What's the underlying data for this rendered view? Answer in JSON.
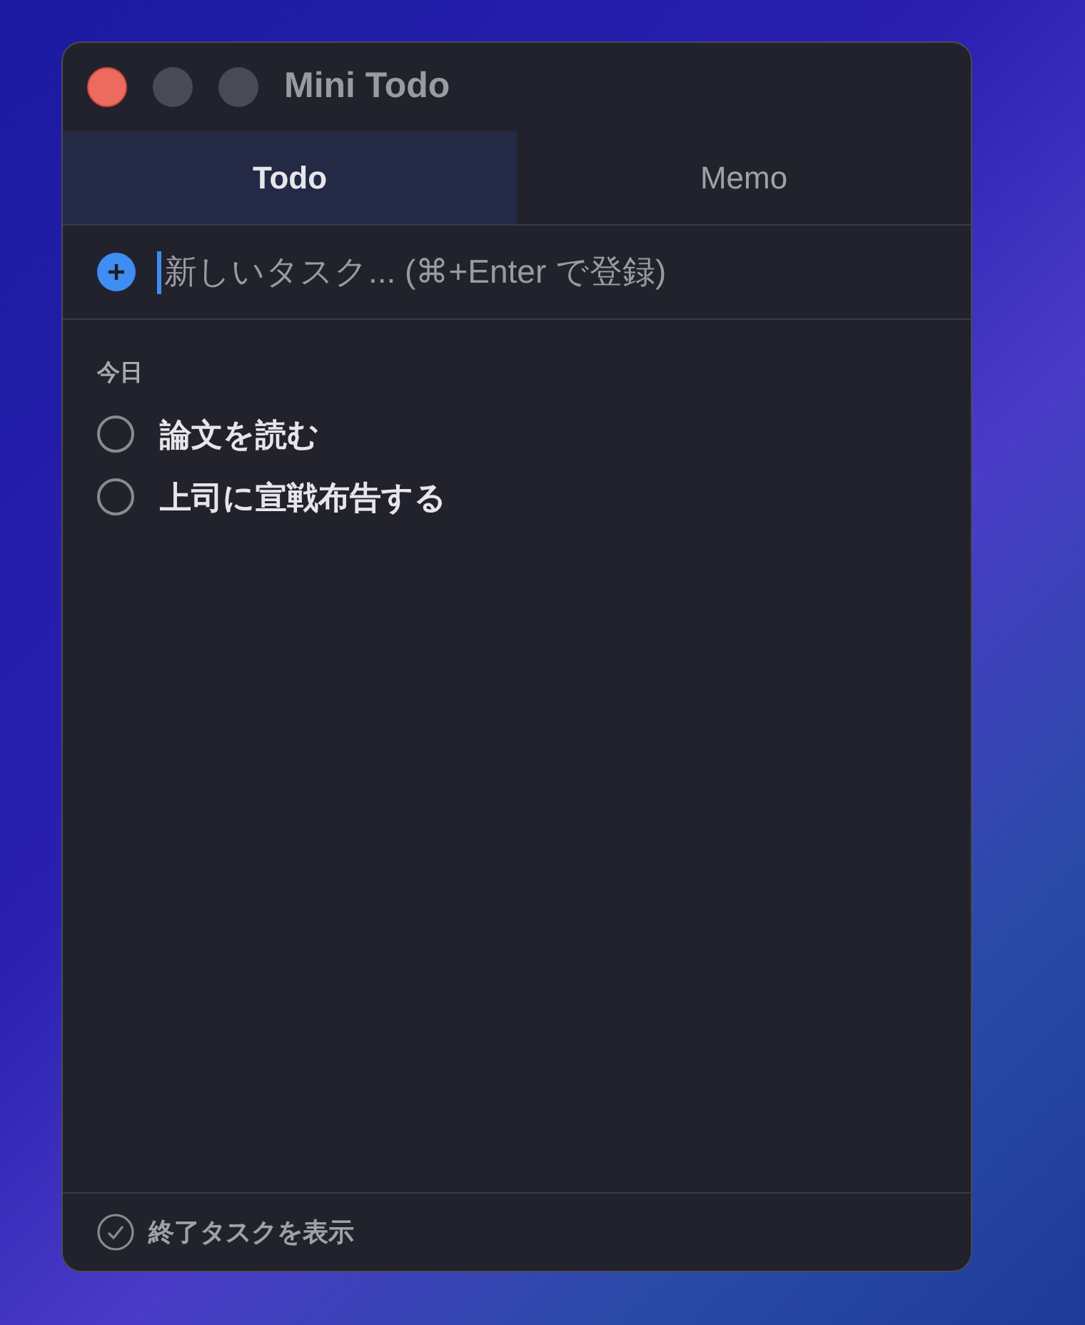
{
  "window": {
    "title": "Mini Todo"
  },
  "tabs": [
    {
      "label": "Todo",
      "selected": true
    },
    {
      "label": "Memo",
      "selected": false
    }
  ],
  "new_task": {
    "placeholder": "新しいタスク... (⌘+Enter で登録)"
  },
  "sections": [
    {
      "heading": "今日",
      "tasks": [
        {
          "label": "論文を読む",
          "checked": false
        },
        {
          "label": "上司に宣戦布告する",
          "checked": false
        }
      ]
    }
  ],
  "footer": {
    "label": "終了タスクを表示"
  }
}
